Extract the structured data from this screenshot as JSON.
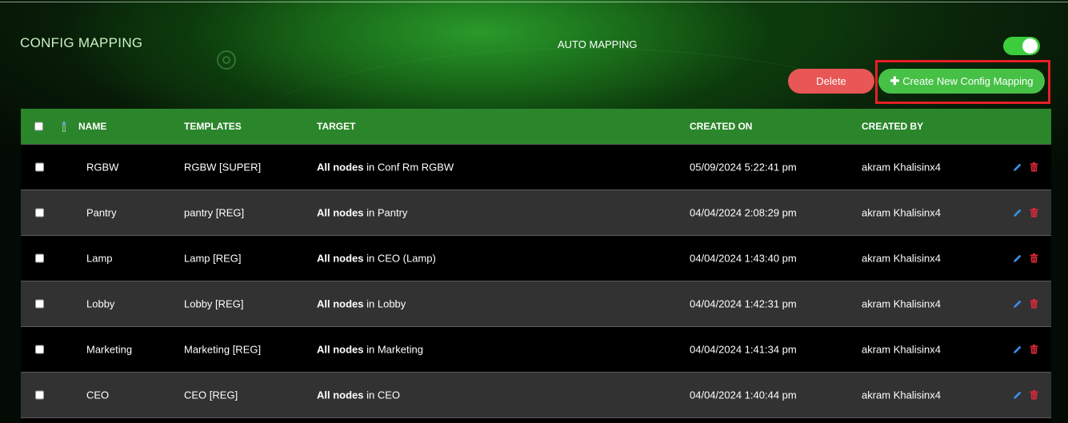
{
  "header": {
    "title": "CONFIG MAPPING",
    "auto_mapping_label": "AUTO MAPPING",
    "auto_mapping_enabled": true
  },
  "actions": {
    "delete_label": "Delete",
    "create_label": "Create New Config Mapping",
    "create_icon": "plus-icon"
  },
  "colors": {
    "accent_green": "#46c146",
    "header_green": "#2b862b",
    "delete_red": "#e95656",
    "highlight_red": "#e61f26",
    "edit_blue": "#3b8ee8",
    "trash_red": "#e0283a"
  },
  "table": {
    "columns": {
      "name": "NAME",
      "templates": "TEMPLATES",
      "target": "TARGET",
      "created_on": "CREATED ON",
      "created_by": "CREATED BY"
    },
    "rows": [
      {
        "name": "RGBW",
        "template": "RGBW [SUPER]",
        "target_bold": "All nodes",
        "target_rest": " in Conf Rm RGBW",
        "created_on": "05/09/2024 5:22:41 pm",
        "created_by": "akram Khalisinx4"
      },
      {
        "name": "Pantry",
        "template": "pantry [REG]",
        "target_bold": "All nodes",
        "target_rest": " in Pantry",
        "created_on": "04/04/2024 2:08:29 pm",
        "created_by": "akram Khalisinx4"
      },
      {
        "name": "Lamp",
        "template": "Lamp [REG]",
        "target_bold": "All nodes",
        "target_rest": " in CEO (Lamp)",
        "created_on": "04/04/2024 1:43:40 pm",
        "created_by": "akram Khalisinx4"
      },
      {
        "name": "Lobby",
        "template": "Lobby [REG]",
        "target_bold": "All nodes",
        "target_rest": " in Lobby",
        "created_on": "04/04/2024 1:42:31 pm",
        "created_by": "akram Khalisinx4"
      },
      {
        "name": "Marketing",
        "template": "Marketing [REG]",
        "target_bold": "All nodes",
        "target_rest": " in Marketing",
        "created_on": "04/04/2024 1:41:34 pm",
        "created_by": "akram Khalisinx4"
      },
      {
        "name": "CEO",
        "template": "CEO [REG]",
        "target_bold": "All nodes",
        "target_rest": " in CEO",
        "created_on": "04/04/2024 1:40:44 pm",
        "created_by": "akram Khalisinx4"
      }
    ]
  }
}
